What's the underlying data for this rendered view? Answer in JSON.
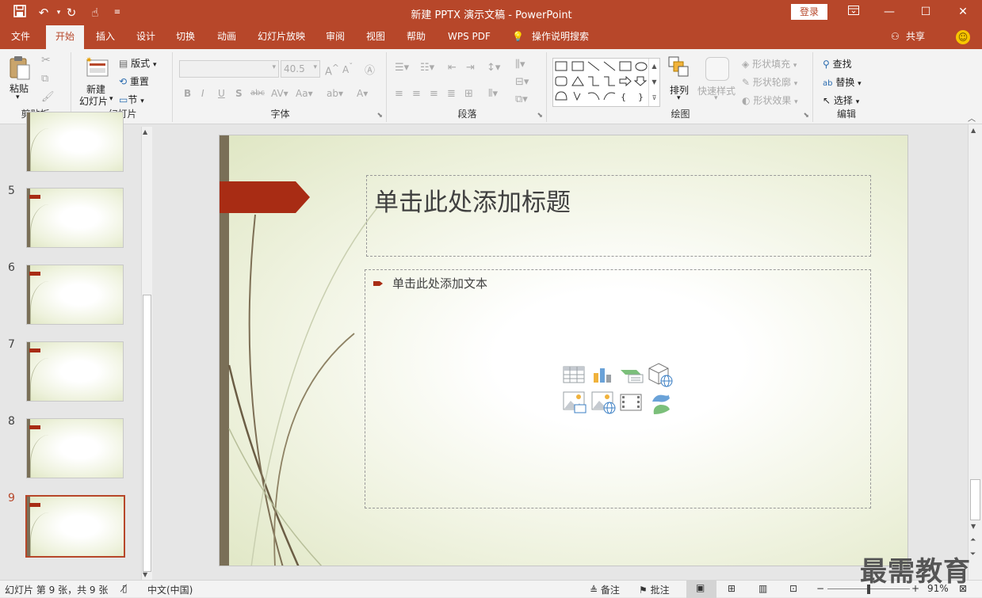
{
  "titlebar": {
    "title": "新建 PPTX 演示文稿 - PowerPoint",
    "login": "登录",
    "qa_icons": [
      "save-icon",
      "undo-icon",
      "redo-icon",
      "touch-mode-icon",
      "customize-icon"
    ],
    "window_icons": [
      "ribbon-options-icon",
      "minimize-icon",
      "maximize-icon",
      "close-icon"
    ]
  },
  "menu": {
    "tabs": [
      "文件",
      "开始",
      "插入",
      "设计",
      "切换",
      "动画",
      "幻灯片放映",
      "审阅",
      "视图",
      "帮助",
      "WPS PDF"
    ],
    "active": "开始",
    "tell_me": "操作说明搜索",
    "share": "共享"
  },
  "ribbon": {
    "clipboard": {
      "label": "剪贴板",
      "paste": "粘贴"
    },
    "slides": {
      "label": "幻灯片",
      "new_slide_line1": "新建",
      "new_slide_line2": "幻灯片",
      "layout": "版式",
      "reset": "重置",
      "section": "节"
    },
    "font": {
      "label": "字体",
      "size": "40.5",
      "family": ""
    },
    "paragraph": {
      "label": "段落"
    },
    "drawing": {
      "label": "绘图",
      "arrange": "排列",
      "quick_styles": "快速样式",
      "shape_fill": "形状填充",
      "shape_outline": "形状轮廓",
      "shape_effects": "形状效果"
    },
    "editing": {
      "label": "编辑",
      "find": "查找",
      "replace": "替换",
      "select": "选择"
    }
  },
  "thumbnails": [
    {
      "num": "",
      "selected": false
    },
    {
      "num": "5",
      "selected": false
    },
    {
      "num": "6",
      "selected": false
    },
    {
      "num": "7",
      "selected": false
    },
    {
      "num": "8",
      "selected": false
    },
    {
      "num": "9",
      "selected": true
    }
  ],
  "slide": {
    "title_placeholder": "单击此处添加标题",
    "body_placeholder": "单击此处添加文本",
    "content_icons": [
      "insert-table-icon",
      "insert-chart-icon",
      "insert-smartart-icon",
      "insert-3d-model-icon",
      "insert-picture-icon",
      "insert-online-picture-icon",
      "insert-video-icon",
      "insert-icons-icon"
    ]
  },
  "status": {
    "slide_info": "幻灯片 第 9 张，共 9 张",
    "language": "中文(中国)",
    "notes": "备注",
    "comments": "批注",
    "zoom": "91%",
    "zoom_fraction": 0.5
  },
  "watermark": "最需教育",
  "colors": {
    "accent": "#b7472a",
    "ribbon_bg": "#f3f3f3",
    "slide_arrow": "#a82c14"
  }
}
